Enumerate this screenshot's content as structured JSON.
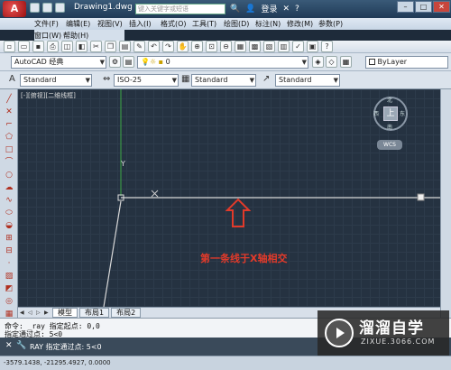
{
  "titlebar": {
    "doc_title": "Drawing1.dwg",
    "search_placeholder": "键入关键字或短语",
    "login": "登录",
    "app_button": "A"
  },
  "menubar": {
    "items": [
      "文件(F)",
      "编辑(E)",
      "视图(V)",
      "插入(I)",
      "格式(O)",
      "工具(T)",
      "绘图(D)",
      "标注(N)",
      "修改(M)",
      "参数(P)",
      "窗口(W)",
      "帮助(H)"
    ]
  },
  "toolbar2": {
    "workspace": "AutoCAD 经典",
    "layer_value": "0",
    "color_value": "ByLayer"
  },
  "toolbar3": {
    "text_style": "Standard",
    "dim_style": "ISO-25",
    "table_style": "Standard",
    "multileader_style": "Standard"
  },
  "viewport": {
    "label": "[-][俯视][二维线框]",
    "ucs_y": "Y",
    "viewcube_top": "上",
    "viewcube_north": "北",
    "viewcube_south": "南",
    "viewcube_east": "东",
    "viewcube_west": "西",
    "wcs": "WCS"
  },
  "annotation": {
    "text": "第一条线于X轴相交",
    "color": "#e23a2a"
  },
  "tabs": {
    "items": [
      "模型",
      "布局1",
      "布局2"
    ]
  },
  "command": {
    "line1": "命令: _ray 指定起点: 0,0",
    "line2": "指定通过点: 5<0",
    "prompt": "RAY 指定通过点: 5<0"
  },
  "status": {
    "coords": "-3579.1438, -21295.4927, 0.0000"
  },
  "watermark": {
    "title": "溜溜自学",
    "url": "ZIXUE.3066.COM"
  }
}
